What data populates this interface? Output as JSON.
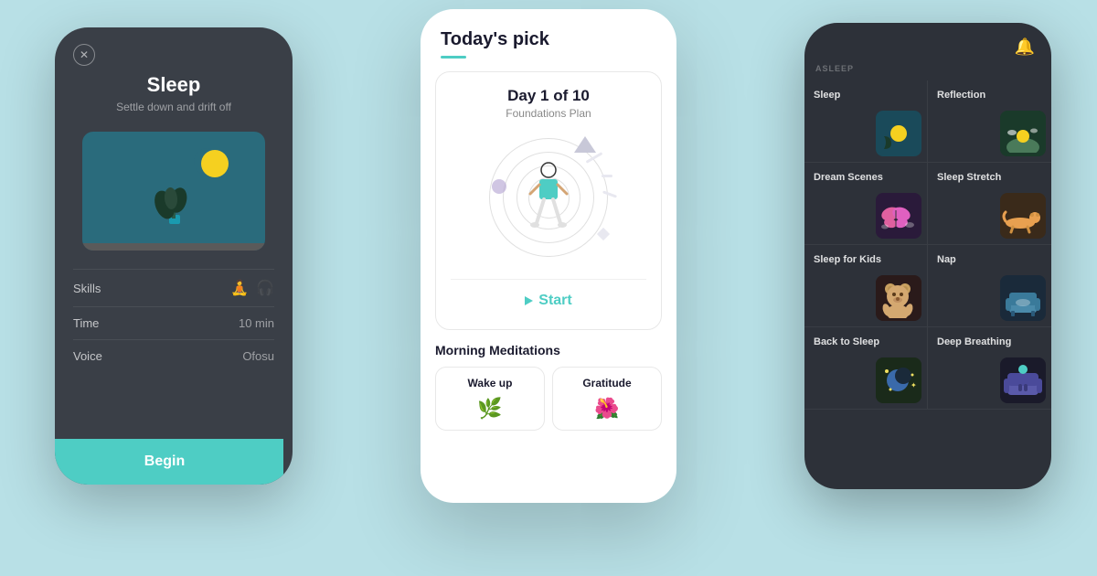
{
  "app": {
    "background_color": "#b8e0e6"
  },
  "left_phone": {
    "title": "Sleep",
    "subtitle": "Settle down and drift off",
    "stats": [
      {
        "label": "Skills",
        "value": ""
      },
      {
        "label": "Time",
        "value": "10 min"
      },
      {
        "label": "Voice",
        "value": "Ofosu"
      }
    ],
    "begin_button": "Begin"
  },
  "center_phone": {
    "header": "Today's pick",
    "day_card": {
      "title": "Day 1 of 10",
      "subtitle": "Foundations Plan",
      "start_label": "Start"
    },
    "morning_section": {
      "title": "Morning Meditations",
      "cards": [
        {
          "label": "Wake up",
          "icon": "🌿"
        },
        {
          "label": "Gratitude",
          "icon": "🌺"
        }
      ]
    }
  },
  "right_phone": {
    "category_label": "ASLEEP",
    "bell_icon": "🔔",
    "grid_cells": [
      {
        "title": "Sleep"
      },
      {
        "title": "Reflection"
      },
      {
        "title": "Dream Scenes"
      },
      {
        "title": "Sleep Stretch"
      },
      {
        "title": "Sleep for Kids"
      },
      {
        "title": "Nap"
      },
      {
        "title": "Back to Sleep"
      },
      {
        "title": "Deep Breathing"
      }
    ]
  }
}
